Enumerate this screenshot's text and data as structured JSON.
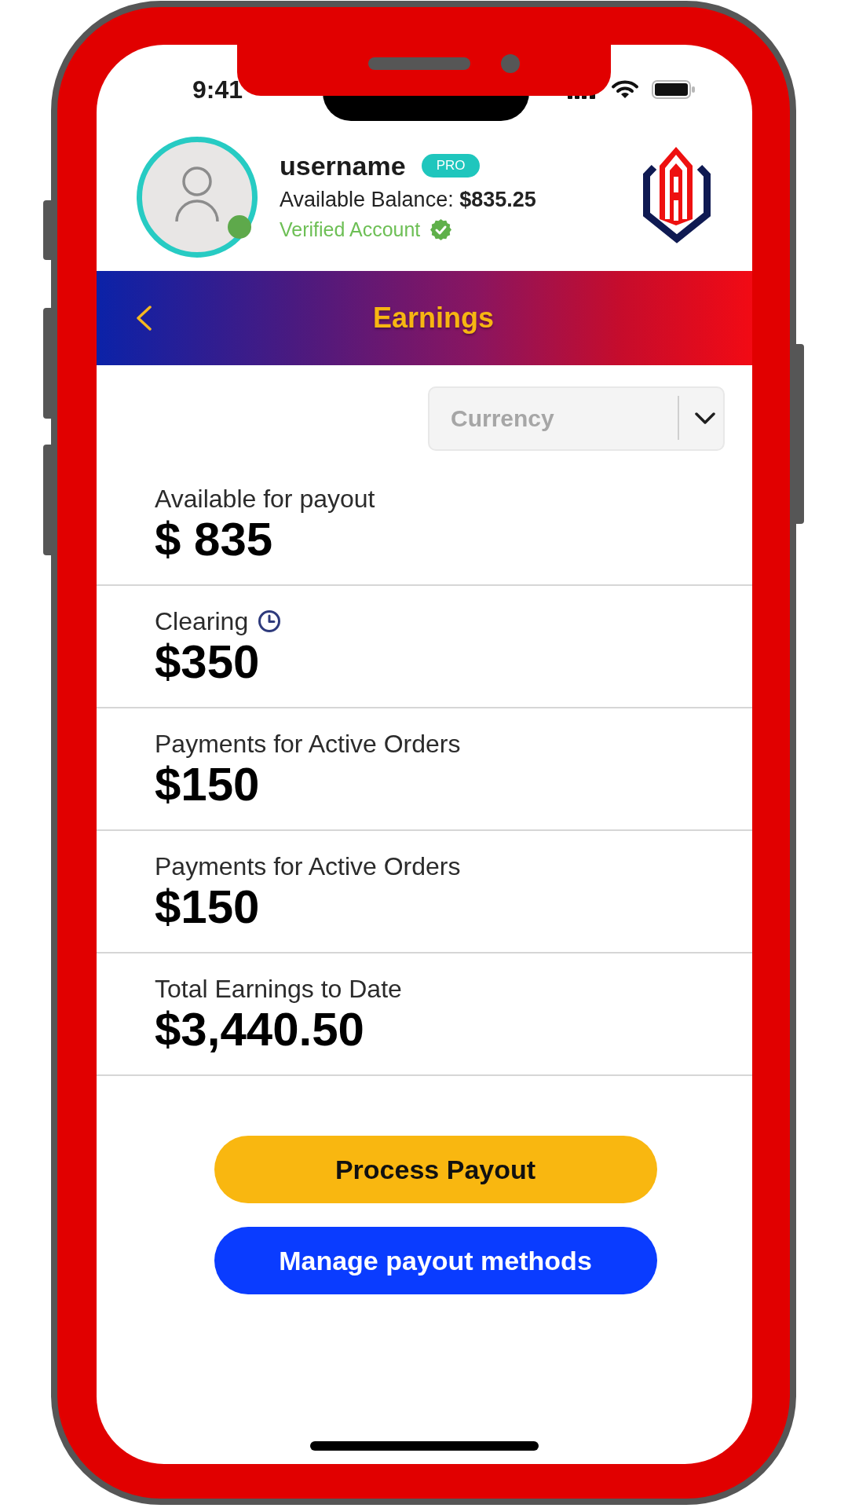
{
  "status_bar": {
    "time": "9:41"
  },
  "profile": {
    "username": "username",
    "badge": "PRO",
    "balance": "Available Balance: **$835.25**",
    "verified": "Verified Account",
    "online": true
  },
  "nav": {
    "title": "Earnings"
  },
  "currency": {
    "placeholder": "Currency"
  },
  "earnings": [
    {
      "label": "Available for payout",
      "amount": "$ 835",
      "kind": "plain"
    },
    {
      "label": "Clearing",
      "amount": "$350",
      "kind": "clearing"
    },
    {
      "label": "Payments for Active Orders",
      "amount": "$150",
      "kind": "plain"
    },
    {
      "label": "Payments for Active Orders",
      "amount": "$150",
      "kind": "plain"
    },
    {
      "label": "Total Earnings to Date",
      "amount": "$3,440.50",
      "kind": "plain"
    }
  ],
  "buttons": [
    {
      "label": "Process Payout",
      "kind": "primary"
    },
    {
      "label": "Manage payout methods",
      "kind": "secondary"
    }
  ]
}
